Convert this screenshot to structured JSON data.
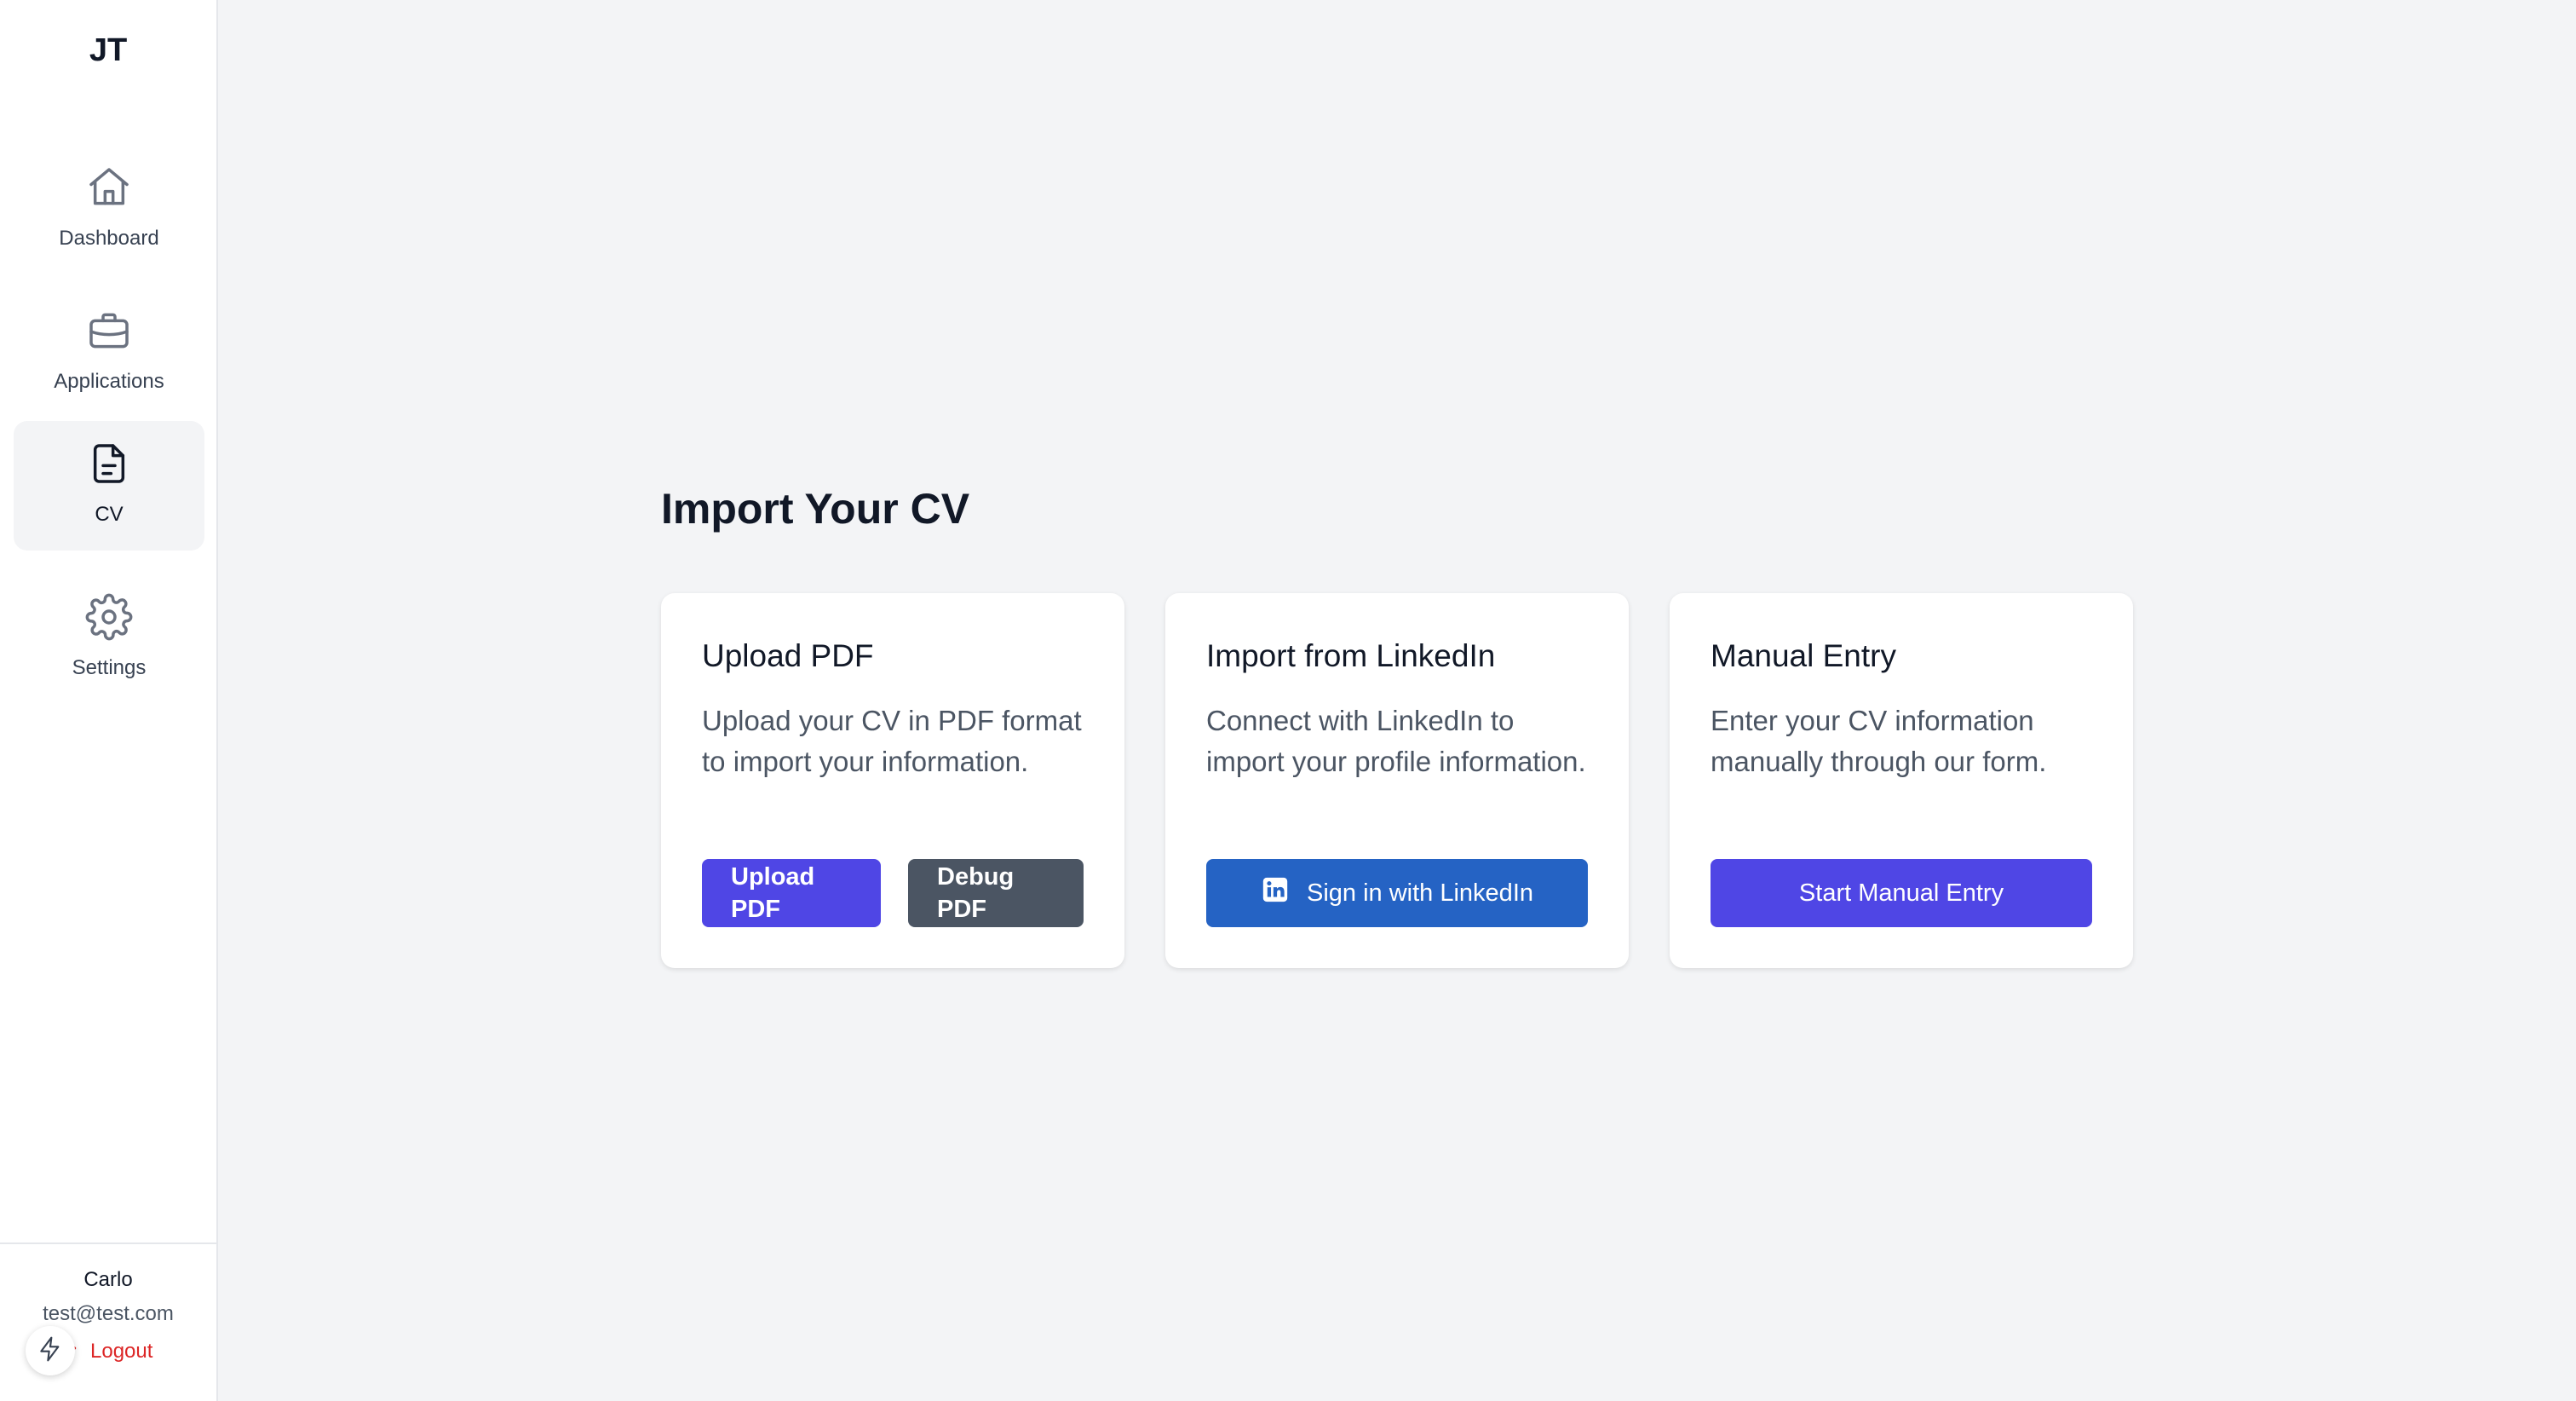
{
  "app": {
    "logo": "JT"
  },
  "sidebar": {
    "items": [
      {
        "label": "Dashboard",
        "icon": "home-icon",
        "active": false
      },
      {
        "label": "Applications",
        "icon": "briefcase-icon",
        "active": false
      },
      {
        "label": "CV",
        "icon": "document-icon",
        "active": true
      },
      {
        "label": "Settings",
        "icon": "gear-icon",
        "active": false
      }
    ],
    "user": {
      "name": "Carlo",
      "email": "test@test.com",
      "logout_label": "Logout"
    }
  },
  "main": {
    "title": "Import Your CV",
    "cards": [
      {
        "title": "Upload PDF",
        "description": "Upload your CV in PDF format to import your information.",
        "buttons": [
          "Upload PDF",
          "Debug PDF"
        ]
      },
      {
        "title": "Import from LinkedIn",
        "description": "Connect with LinkedIn to import your profile information.",
        "buttons": [
          "Sign in with LinkedIn"
        ]
      },
      {
        "title": "Manual Entry",
        "description": "Enter your CV information manually through our form.",
        "buttons": [
          "Start Manual Entry"
        ]
      }
    ]
  },
  "colors": {
    "accent": "#4f46e5",
    "linkedin": "#2563c4",
    "secondary_button": "#4b5563",
    "logout": "#dc2626"
  }
}
